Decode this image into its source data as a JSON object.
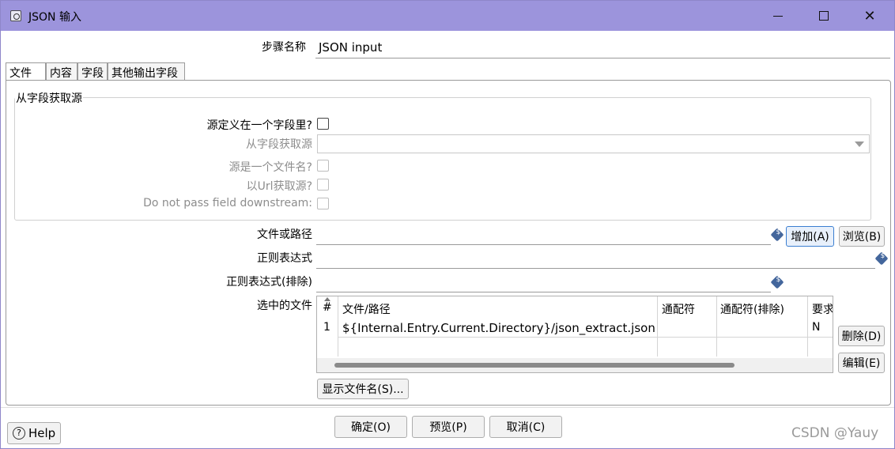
{
  "window": {
    "title": "JSON 输入",
    "icon": "step-icon"
  },
  "step": {
    "label": "步骤名称",
    "value": "JSON input"
  },
  "tabs": [
    {
      "label": "文件",
      "active": true
    },
    {
      "label": "内容",
      "active": false
    },
    {
      "label": "字段",
      "active": false
    },
    {
      "label": "其他输出字段",
      "active": false
    }
  ],
  "source_group": {
    "title": "从字段获取源",
    "source_in_field_label": "源定义在一个字段里?",
    "source_field_label": "从字段获取源",
    "source_is_filename_label": "源是一个文件名?",
    "source_from_url_label": "以Url获取源?",
    "do_not_pass_label": "Do not pass field downstream:"
  },
  "file": {
    "path_label": "文件或路径",
    "path_value": "",
    "add_button": "增加(A)",
    "browse_button": "浏览(B)",
    "regex_label": "正则表达式",
    "regex_value": "",
    "regex_exclude_label": "正则表达式(排除)",
    "regex_exclude_value": "",
    "selected_files_label": "选中的文件"
  },
  "files_table": {
    "columns": [
      "#",
      "文件/路径",
      "通配符",
      "通配符(排除)",
      "要求"
    ],
    "rows": [
      {
        "num": "1",
        "path": "${Internal.Entry.Current.Directory}/json_extract.json",
        "wildcard": "",
        "wildcard_exclude": "",
        "required": "N"
      }
    ],
    "delete_button": "删除(D)",
    "edit_button": "编辑(E)",
    "show_filenames_button": "显示文件名(S)..."
  },
  "footer": {
    "help_button": "Help",
    "ok_button": "确定(O)",
    "preview_button": "预览(P)",
    "cancel_button": "取消(C)"
  },
  "watermark": "CSDN @Yauy"
}
